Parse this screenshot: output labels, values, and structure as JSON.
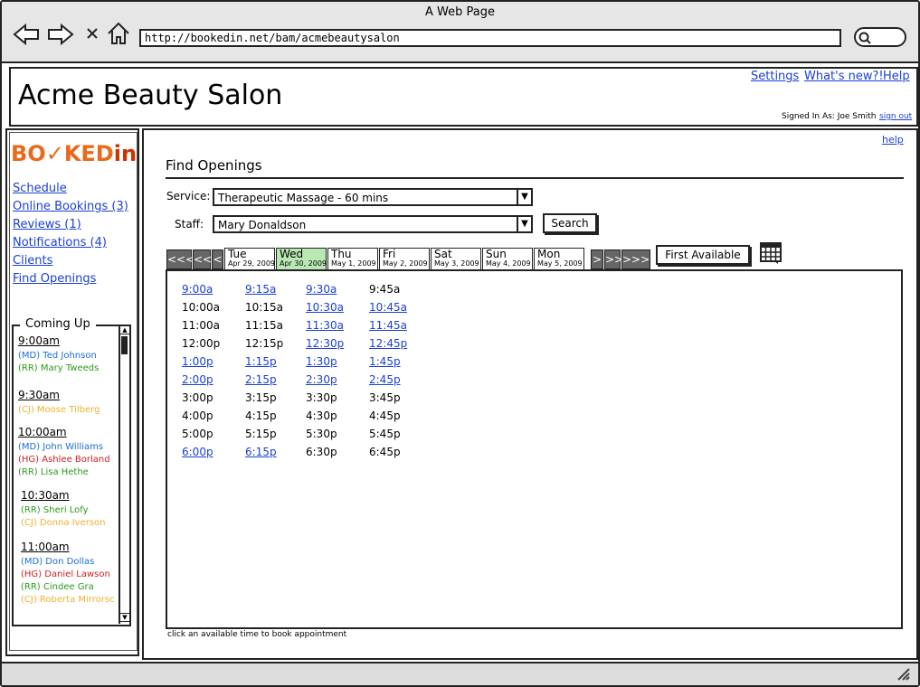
{
  "browser": {
    "window_title": "A Web Page",
    "url": "http://bookedin.net/bam/acmebeautysalon"
  },
  "header": {
    "title": "Acme Beauty Salon",
    "links": [
      "Settings",
      "What's new?!",
      "Help"
    ],
    "signed_in": "Signed In As: Joe Smith",
    "sign_out": "sign out"
  },
  "sidebar": {
    "logo": {
      "part1": "BO",
      "check": "✓",
      "part2": "KED",
      "part3": "in"
    },
    "nav": [
      "Schedule",
      "Online Bookings (3)",
      "Reviews (1)",
      "Notifications (4)",
      "Clients",
      "Find Openings"
    ],
    "coming_up": {
      "title": "Coming Up",
      "slots": [
        {
          "time": "9:00am",
          "appts": [
            {
              "text": "(MD) Ted Johnson",
              "color": "#1a6fd6"
            },
            {
              "text": "(RR) Mary Tweeds",
              "color": "#2a9a1a"
            }
          ]
        },
        {
          "time": "9:30am",
          "appts": [
            {
              "text": "(CJ) Moose Tilberg",
              "color": "#f0b030"
            }
          ]
        },
        {
          "time": "10:00am",
          "appts": [
            {
              "text": "(MD) John Williams",
              "color": "#1a6fd6"
            },
            {
              "text": "(HG) Ashlee Borland",
              "color": "#d42020"
            },
            {
              "text": "(RR) Lisa Hethe",
              "color": "#2a9a1a"
            }
          ]
        },
        {
          "time": "10:30am",
          "appts": [
            {
              "text": "(RR) Sheri Lofy",
              "color": "#2a9a1a"
            },
            {
              "text": "(CJ) Donna Iverson",
              "color": "#f0b030"
            }
          ]
        },
        {
          "time": "11:00am",
          "appts": [
            {
              "text": "(MD) Don Dollas",
              "color": "#1a6fd6"
            },
            {
              "text": "(HG) Daniel Lawson",
              "color": "#d42020"
            },
            {
              "text": "(RR) Cindee Gra",
              "color": "#2a9a1a"
            },
            {
              "text": "(CJ) Roberta Mirrorsc",
              "color": "#f0b030"
            }
          ]
        }
      ]
    }
  },
  "main": {
    "help": "help",
    "title": "Find Openings",
    "service_label": "Service:",
    "service_value": "Therapeutic Massage - 60 mins",
    "staff_label": "Staff:",
    "staff_value": "Mary Donaldson",
    "search_label": "Search",
    "first_available_label": "First Available",
    "nav_left": [
      "<<<",
      "<<",
      "<"
    ],
    "nav_right": [
      ">",
      ">>",
      ">>>"
    ],
    "days": [
      {
        "day": "Tue",
        "date": "Apr 29, 2009",
        "active": false
      },
      {
        "day": "Wed",
        "date": "Apr 30, 2009",
        "active": true
      },
      {
        "day": "Thu",
        "date": "May 1, 2009",
        "active": false
      },
      {
        "day": "Fri",
        "date": "May 2, 2009",
        "active": false
      },
      {
        "day": "Sat",
        "date": "May 3, 2009",
        "active": false
      },
      {
        "day": "Sun",
        "date": "May 4, 2009",
        "active": false
      },
      {
        "day": "Mon",
        "date": "May 5, 2009",
        "active": false
      }
    ],
    "times": [
      [
        {
          "t": "9:00a",
          "a": true
        },
        {
          "t": "9:15a",
          "a": true
        },
        {
          "t": "9:30a",
          "a": true
        },
        {
          "t": "9:45a",
          "a": false
        }
      ],
      [
        {
          "t": "10:00a",
          "a": false
        },
        {
          "t": "10:15a",
          "a": false
        },
        {
          "t": "10:30a",
          "a": true
        },
        {
          "t": "10:45a",
          "a": true
        }
      ],
      [
        {
          "t": "11:00a",
          "a": false
        },
        {
          "t": "11:15a",
          "a": false
        },
        {
          "t": "11:30a",
          "a": true
        },
        {
          "t": "11:45a",
          "a": true
        }
      ],
      [
        {
          "t": "12:00p",
          "a": false
        },
        {
          "t": "12:15p",
          "a": false
        },
        {
          "t": "12:30p",
          "a": true
        },
        {
          "t": "12:45p",
          "a": true
        }
      ],
      [
        {
          "t": "1:00p",
          "a": true
        },
        {
          "t": "1:15p",
          "a": true
        },
        {
          "t": "1:30p",
          "a": true
        },
        {
          "t": "1:45p",
          "a": true
        }
      ],
      [
        {
          "t": "2:00p",
          "a": true
        },
        {
          "t": "2:15p",
          "a": true
        },
        {
          "t": "2:30p",
          "a": true
        },
        {
          "t": "2:45p",
          "a": true
        }
      ],
      [
        {
          "t": "3:00p",
          "a": false
        },
        {
          "t": "3:15p",
          "a": false
        },
        {
          "t": "3:30p",
          "a": false
        },
        {
          "t": "3:45p",
          "a": false
        }
      ],
      [
        {
          "t": "4:00p",
          "a": false
        },
        {
          "t": "4:15p",
          "a": false
        },
        {
          "t": "4:30p",
          "a": false
        },
        {
          "t": "4:45p",
          "a": false
        }
      ],
      [
        {
          "t": "5:00p",
          "a": false
        },
        {
          "t": "5:15p",
          "a": false
        },
        {
          "t": "5:30p",
          "a": false
        },
        {
          "t": "5:45p",
          "a": false
        }
      ],
      [
        {
          "t": "6:00p",
          "a": true
        },
        {
          "t": "6:15p",
          "a": true
        },
        {
          "t": "6:30p",
          "a": false
        },
        {
          "t": "6:45p",
          "a": false
        }
      ]
    ],
    "footnote": "click an available time to book appointment"
  }
}
